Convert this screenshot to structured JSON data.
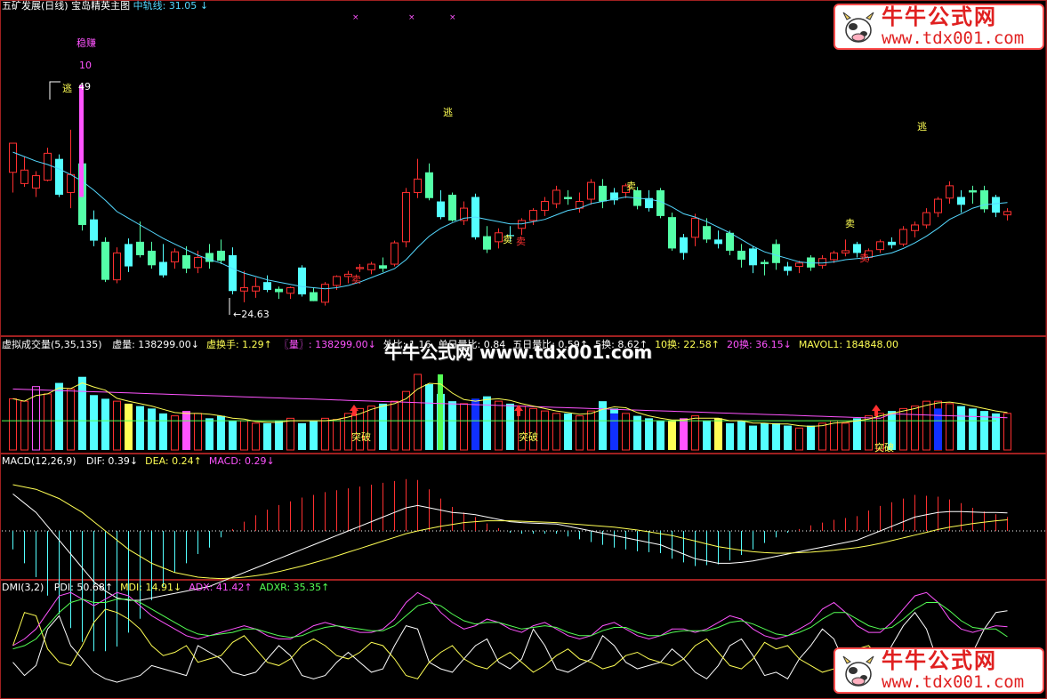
{
  "colors": {
    "up": "#ff3030",
    "down": "#54ffa8",
    "down_alt": "#54ffff",
    "ma": "#54d8ff",
    "white": "#ffffff",
    "yellow": "#ffff54",
    "magenta": "#ff54ff",
    "green": "#54ff54",
    "frame": "#a02020",
    "blue": "#1030ff"
  },
  "main": {
    "stock_title": "五矿发展(日线)",
    "indicator_title": "宝岛精英主图",
    "mid_line_label": "中轨线:",
    "mid_line_value": "31.05",
    "mid_line_arrow": "↓",
    "labels": {
      "wenzhuan": "稳赚",
      "ten": "10",
      "high_marker": "逃",
      "high_value": "49",
      "low_value": "24.63",
      "escape1": "逃",
      "escape2": "逃",
      "sell": "卖",
      "sell_label_2": "卖",
      "sell_label_3": "卖",
      "buy_sell_a": "卖",
      "buy_sell_b": "卖",
      "sell_label_4": "卖"
    }
  },
  "volume": {
    "title": "虚拟成交量(5,35,135)",
    "fields": [
      {
        "label": "虚量:",
        "value": "138299.00",
        "arrow": "↓",
        "color": "white"
      },
      {
        "label": "虚换手:",
        "value": "1.29",
        "arrow": "↑",
        "color": "yellow"
      },
      {
        "label": "〖量〗:",
        "value": "138299.00",
        "arrow": "↓",
        "color": "magenta"
      },
      {
        "label": "外比:",
        "value": "1.16",
        "arrow": "",
        "color": "white"
      },
      {
        "label": "单日量比:",
        "value": "0.84",
        "arrow": "",
        "color": "white"
      },
      {
        "label": "五日量比:",
        "value": "0.59",
        "arrow": "↑",
        "color": "white"
      },
      {
        "label": "5换:",
        "value": "8.62",
        "arrow": "↑",
        "color": "white"
      },
      {
        "label": "10换:",
        "value": "22.58",
        "arrow": "↑",
        "color": "yellow"
      },
      {
        "label": "20换:",
        "value": "36.15",
        "arrow": "↓",
        "color": "magenta"
      },
      {
        "label": "MAVOL1:",
        "value": "184848.00",
        "arrow": "",
        "color": "yellow"
      }
    ],
    "breakout_label": "突破"
  },
  "macd": {
    "title": "MACD(12,26,9)",
    "fields": [
      {
        "label": "DIF:",
        "value": "0.39",
        "arrow": "↓",
        "color": "white"
      },
      {
        "label": "DEA:",
        "value": "0.24",
        "arrow": "↑",
        "color": "yellow"
      },
      {
        "label": "MACD:",
        "value": "0.29",
        "arrow": "↓",
        "color": "magenta"
      }
    ]
  },
  "dmi": {
    "title": "DMI(3,2)",
    "fields": [
      {
        "label": "PDI:",
        "value": "50.68",
        "arrow": "↑",
        "color": "white"
      },
      {
        "label": "MDI:",
        "value": "14.91",
        "arrow": "↓",
        "color": "yellow"
      },
      {
        "label": "ADX:",
        "value": "41.42",
        "arrow": "↑",
        "color": "magenta"
      },
      {
        "label": "ADXR:",
        "value": "35.35",
        "arrow": "↑",
        "color": "green"
      }
    ]
  },
  "watermark": {
    "brand": "牛牛公式网",
    "url": "www.tdx001.com",
    "banner": "牛牛公式网 www.tdx001.com"
  },
  "chart_data": {
    "type": "candlestick",
    "price_range": [
      23,
      50
    ],
    "candles": [
      {
        "o": 36.2,
        "h": 37.4,
        "l": 34.4,
        "c": 38.8
      },
      {
        "o": 35.2,
        "h": 37.6,
        "l": 34.9,
        "c": 36.4
      },
      {
        "o": 34.8,
        "h": 36.3,
        "l": 34.0,
        "c": 35.9
      },
      {
        "o": 35.5,
        "h": 38.4,
        "l": 35.4,
        "c": 37.9
      },
      {
        "o": 37.4,
        "h": 37.8,
        "l": 34.0,
        "c": 34.2
      },
      {
        "o": 34.4,
        "h": 40.0,
        "l": 33.0,
        "c": 36.0
      },
      {
        "o": 37.0,
        "h": 37.5,
        "l": 31.0,
        "c": 31.5
      },
      {
        "o": 32.0,
        "h": 32.8,
        "l": 29.6,
        "c": 30.1
      },
      {
        "o": 30.0,
        "h": 30.4,
        "l": 26.4,
        "c": 26.6
      },
      {
        "o": 26.6,
        "h": 29.5,
        "l": 26.3,
        "c": 29.0
      },
      {
        "o": 29.8,
        "h": 30.3,
        "l": 27.3,
        "c": 27.8
      },
      {
        "o": 30.0,
        "h": 31.8,
        "l": 28.6,
        "c": 28.8
      },
      {
        "o": 29.2,
        "h": 30.0,
        "l": 27.6,
        "c": 27.9
      },
      {
        "o": 28.2,
        "h": 29.8,
        "l": 26.8,
        "c": 27.0
      },
      {
        "o": 28.2,
        "h": 29.4,
        "l": 27.6,
        "c": 29.1
      },
      {
        "o": 28.8,
        "h": 29.6,
        "l": 27.2,
        "c": 27.6
      },
      {
        "o": 27.7,
        "h": 29.2,
        "l": 27.2,
        "c": 28.6
      },
      {
        "o": 29.0,
        "h": 29.8,
        "l": 27.6,
        "c": 28.2
      },
      {
        "o": 29.2,
        "h": 30.2,
        "l": 28.0,
        "c": 28.3
      },
      {
        "o": 28.8,
        "h": 29.5,
        "l": 25.3,
        "c": 25.6
      },
      {
        "o": 25.6,
        "h": 27.4,
        "l": 24.6,
        "c": 25.9
      },
      {
        "o": 25.6,
        "h": 26.8,
        "l": 25.0,
        "c": 26.0
      },
      {
        "o": 26.4,
        "h": 27.0,
        "l": 25.5,
        "c": 25.7
      },
      {
        "o": 25.8,
        "h": 26.0,
        "l": 24.9,
        "c": 25.5
      },
      {
        "o": 25.4,
        "h": 26.0,
        "l": 24.9,
        "c": 25.9
      },
      {
        "o": 27.7,
        "h": 27.9,
        "l": 25.1,
        "c": 25.3
      },
      {
        "o": 25.5,
        "h": 25.9,
        "l": 24.8,
        "c": 24.7
      },
      {
        "o": 24.6,
        "h": 26.4,
        "l": 24.3,
        "c": 26.2
      },
      {
        "o": 26.1,
        "h": 27.0,
        "l": 25.7,
        "c": 26.9
      },
      {
        "o": 26.9,
        "h": 27.4,
        "l": 26.3,
        "c": 27.1
      },
      {
        "o": 27.6,
        "h": 28.0,
        "l": 27.3,
        "c": 27.7
      },
      {
        "o": 27.5,
        "h": 28.2,
        "l": 27.1,
        "c": 28.0
      },
      {
        "o": 27.9,
        "h": 28.6,
        "l": 27.3,
        "c": 27.6
      },
      {
        "o": 28.0,
        "h": 30.1,
        "l": 27.8,
        "c": 29.9
      },
      {
        "o": 30.0,
        "h": 34.8,
        "l": 29.5,
        "c": 34.4
      },
      {
        "o": 34.4,
        "h": 37.4,
        "l": 33.9,
        "c": 35.6
      },
      {
        "o": 36.2,
        "h": 37.0,
        "l": 33.7,
        "c": 33.9
      },
      {
        "o": 33.6,
        "h": 34.6,
        "l": 32.0,
        "c": 32.2
      },
      {
        "o": 34.2,
        "h": 34.4,
        "l": 31.8,
        "c": 31.9
      },
      {
        "o": 31.9,
        "h": 33.6,
        "l": 31.5,
        "c": 33.0
      },
      {
        "o": 34.0,
        "h": 34.3,
        "l": 30.2,
        "c": 30.4
      },
      {
        "o": 30.5,
        "h": 31.4,
        "l": 29.0,
        "c": 29.3
      },
      {
        "o": 30.0,
        "h": 31.2,
        "l": 29.4,
        "c": 30.8
      },
      {
        "o": 30.6,
        "h": 31.4,
        "l": 30.0,
        "c": 30.5
      },
      {
        "o": 31.2,
        "h": 32.1,
        "l": 30.6,
        "c": 31.9
      },
      {
        "o": 31.9,
        "h": 33.0,
        "l": 31.5,
        "c": 32.8
      },
      {
        "o": 32.8,
        "h": 34.0,
        "l": 32.3,
        "c": 33.6
      },
      {
        "o": 33.4,
        "h": 35.0,
        "l": 33.0,
        "c": 34.6
      },
      {
        "o": 34.0,
        "h": 34.6,
        "l": 33.3,
        "c": 33.8
      },
      {
        "o": 33.0,
        "h": 34.4,
        "l": 32.6,
        "c": 33.6
      },
      {
        "o": 33.8,
        "h": 35.6,
        "l": 33.3,
        "c": 35.3
      },
      {
        "o": 35.0,
        "h": 35.6,
        "l": 33.0,
        "c": 33.6
      },
      {
        "o": 34.4,
        "h": 34.8,
        "l": 33.3,
        "c": 33.7
      },
      {
        "o": 34.4,
        "h": 35.2,
        "l": 33.9,
        "c": 35.0
      },
      {
        "o": 34.6,
        "h": 34.9,
        "l": 32.9,
        "c": 33.2
      },
      {
        "o": 33.9,
        "h": 34.6,
        "l": 32.7,
        "c": 33.0
      },
      {
        "o": 34.6,
        "h": 34.8,
        "l": 32.1,
        "c": 32.3
      },
      {
        "o": 32.2,
        "h": 32.6,
        "l": 29.2,
        "c": 29.4
      },
      {
        "o": 30.4,
        "h": 30.7,
        "l": 28.4,
        "c": 29.0
      },
      {
        "o": 30.4,
        "h": 32.5,
        "l": 29.6,
        "c": 32.1
      },
      {
        "o": 31.4,
        "h": 32.1,
        "l": 29.9,
        "c": 30.2
      },
      {
        "o": 30.2,
        "h": 31.0,
        "l": 29.4,
        "c": 29.8
      },
      {
        "o": 30.8,
        "h": 31.0,
        "l": 28.8,
        "c": 29.2
      },
      {
        "o": 29.2,
        "h": 29.8,
        "l": 27.7,
        "c": 28.4
      },
      {
        "o": 29.4,
        "h": 29.6,
        "l": 27.2,
        "c": 27.9
      },
      {
        "o": 28.2,
        "h": 28.4,
        "l": 27.0,
        "c": 28.0
      },
      {
        "o": 29.8,
        "h": 30.2,
        "l": 27.5,
        "c": 28.1
      },
      {
        "o": 27.8,
        "h": 28.2,
        "l": 27.0,
        "c": 27.4
      },
      {
        "o": 27.8,
        "h": 28.3,
        "l": 27.2,
        "c": 28.1
      },
      {
        "o": 28.6,
        "h": 28.8,
        "l": 27.4,
        "c": 27.7
      },
      {
        "o": 27.9,
        "h": 28.8,
        "l": 27.6,
        "c": 28.5
      },
      {
        "o": 28.4,
        "h": 29.2,
        "l": 28.1,
        "c": 29.0
      },
      {
        "o": 29.0,
        "h": 30.2,
        "l": 28.7,
        "c": 29.2
      },
      {
        "o": 29.8,
        "h": 30.0,
        "l": 28.6,
        "c": 29.0
      },
      {
        "o": 28.6,
        "h": 29.4,
        "l": 28.3,
        "c": 29.2
      },
      {
        "o": 29.3,
        "h": 30.2,
        "l": 29.0,
        "c": 30.0
      },
      {
        "o": 30.0,
        "h": 30.4,
        "l": 29.4,
        "c": 29.7
      },
      {
        "o": 29.8,
        "h": 31.4,
        "l": 29.6,
        "c": 31.1
      },
      {
        "o": 31.0,
        "h": 31.8,
        "l": 30.4,
        "c": 31.5
      },
      {
        "o": 31.5,
        "h": 33.0,
        "l": 31.2,
        "c": 32.6
      },
      {
        "o": 32.6,
        "h": 34.0,
        "l": 32.2,
        "c": 33.8
      },
      {
        "o": 33.9,
        "h": 35.4,
        "l": 33.4,
        "c": 35.0
      },
      {
        "o": 34.0,
        "h": 34.6,
        "l": 32.6,
        "c": 33.3
      },
      {
        "o": 34.6,
        "h": 35.0,
        "l": 33.4,
        "c": 34.4
      },
      {
        "o": 34.6,
        "h": 35.0,
        "l": 32.6,
        "c": 32.9
      },
      {
        "o": 34.0,
        "h": 34.2,
        "l": 32.2,
        "c": 32.6
      },
      {
        "o": 32.4,
        "h": 33.0,
        "l": 31.9,
        "c": 32.7
      }
    ],
    "ma": [
      38.0,
      37.6,
      37.2,
      36.9,
      36.5,
      36.0,
      35.4,
      34.6,
      33.7,
      32.7,
      32.1,
      31.5,
      30.9,
      30.3,
      29.8,
      29.3,
      28.8,
      28.4,
      28.1,
      27.6,
      27.2,
      26.9,
      26.6,
      26.4,
      26.2,
      26.0,
      25.9,
      25.8,
      25.9,
      26.1,
      26.4,
      26.8,
      27.2,
      27.6,
      28.4,
      29.5,
      30.5,
      31.2,
      31.7,
      32.1,
      32.2,
      32.0,
      31.8,
      31.6,
      31.6,
      31.8,
      32.0,
      32.4,
      32.8,
      33.0,
      33.4,
      33.6,
      33.8,
      34.0,
      33.9,
      33.8,
      33.6,
      33.1,
      32.5,
      32.2,
      31.8,
      31.3,
      30.8,
      30.2,
      29.6,
      29.1,
      28.8,
      28.5,
      28.2,
      28.1,
      28.1,
      28.2,
      28.4,
      28.5,
      28.6,
      28.8,
      29.0,
      29.4,
      29.9,
      30.5,
      31.2,
      32.0,
      32.5,
      33.0,
      33.3,
      33.4,
      33.5
    ],
    "volume": [
      42,
      40,
      52,
      46,
      55,
      50,
      60,
      45,
      42,
      40,
      38,
      36,
      34,
      30,
      28,
      32,
      30,
      26,
      28,
      24,
      24,
      22,
      22,
      24,
      26,
      22,
      24,
      26,
      25,
      30,
      34,
      36,
      38,
      40,
      48,
      62,
      54,
      46,
      40,
      38,
      42,
      44,
      40,
      38,
      36,
      34,
      32,
      30,
      30,
      28,
      32,
      40,
      34,
      30,
      28,
      26,
      24,
      24,
      26,
      28,
      24,
      26,
      22,
      24,
      20,
      22,
      22,
      20,
      18,
      20,
      22,
      24,
      22,
      26,
      28,
      30,
      32,
      34,
      36,
      40,
      40,
      38,
      36,
      34,
      32,
      30,
      30
    ],
    "macd_dif": [
      0.8,
      0.6,
      0.4,
      0.1,
      -0.2,
      -0.5,
      -0.8,
      -1.1,
      -1.3,
      -1.45,
      -1.5,
      -1.5,
      -1.45,
      -1.4,
      -1.35,
      -1.3,
      -1.25,
      -1.2,
      -1.1,
      -1.0,
      -0.9,
      -0.8,
      -0.7,
      -0.6,
      -0.5,
      -0.4,
      -0.3,
      -0.2,
      -0.1,
      0.0,
      0.1,
      0.2,
      0.3,
      0.4,
      0.5,
      0.55,
      0.5,
      0.45,
      0.4,
      0.38,
      0.35,
      0.3,
      0.25,
      0.2,
      0.18,
      0.17,
      0.16,
      0.15,
      0.1,
      0.05,
      0.0,
      -0.05,
      -0.1,
      -0.15,
      -0.2,
      -0.25,
      -0.3,
      -0.4,
      -0.5,
      -0.6,
      -0.65,
      -0.7,
      -0.7,
      -0.68,
      -0.65,
      -0.6,
      -0.55,
      -0.5,
      -0.45,
      -0.4,
      -0.35,
      -0.3,
      -0.25,
      -0.2,
      -0.1,
      0.0,
      0.1,
      0.2,
      0.3,
      0.35,
      0.4,
      0.42,
      0.42,
      0.41,
      0.4,
      0.4,
      0.39
    ],
    "macd_dea": [
      1.0,
      0.95,
      0.9,
      0.8,
      0.7,
      0.55,
      0.4,
      0.2,
      0.0,
      -0.2,
      -0.4,
      -0.55,
      -0.7,
      -0.8,
      -0.9,
      -0.95,
      -1.0,
      -1.02,
      -1.03,
      -1.02,
      -1.0,
      -0.97,
      -0.93,
      -0.88,
      -0.82,
      -0.76,
      -0.69,
      -0.62,
      -0.54,
      -0.46,
      -0.38,
      -0.3,
      -0.22,
      -0.14,
      -0.06,
      0.0,
      0.05,
      0.1,
      0.14,
      0.18,
      0.2,
      0.22,
      0.22,
      0.22,
      0.21,
      0.2,
      0.19,
      0.18,
      0.16,
      0.14,
      0.12,
      0.1,
      0.08,
      0.05,
      0.02,
      -0.02,
      -0.06,
      -0.1,
      -0.16,
      -0.22,
      -0.28,
      -0.34,
      -0.38,
      -0.42,
      -0.45,
      -0.47,
      -0.48,
      -0.48,
      -0.47,
      -0.46,
      -0.44,
      -0.42,
      -0.39,
      -0.36,
      -0.32,
      -0.27,
      -0.21,
      -0.15,
      -0.09,
      -0.03,
      0.03,
      0.08,
      0.12,
      0.16,
      0.19,
      0.22,
      0.24
    ],
    "dmi_pdi": [
      20,
      12,
      18,
      40,
      48,
      30,
      22,
      14,
      10,
      8,
      10,
      12,
      18,
      16,
      14,
      12,
      30,
      26,
      22,
      14,
      12,
      14,
      22,
      30,
      24,
      12,
      10,
      12,
      20,
      26,
      20,
      14,
      16,
      30,
      42,
      40,
      20,
      16,
      14,
      22,
      30,
      34,
      20,
      16,
      22,
      40,
      30,
      16,
      14,
      18,
      22,
      36,
      30,
      20,
      16,
      18,
      20,
      28,
      22,
      14,
      10,
      18,
      30,
      34,
      24,
      12,
      14,
      10,
      22,
      30,
      40,
      34,
      18,
      12,
      10,
      16,
      30,
      42,
      50,
      40,
      20,
      12,
      16,
      26,
      40,
      50,
      51
    ],
    "dmi_mdi": [
      30,
      50,
      48,
      28,
      20,
      18,
      30,
      44,
      52,
      50,
      46,
      40,
      30,
      24,
      26,
      30,
      20,
      22,
      24,
      32,
      36,
      28,
      20,
      18,
      22,
      30,
      34,
      30,
      24,
      22,
      26,
      32,
      30,
      22,
      12,
      10,
      20,
      26,
      30,
      22,
      18,
      16,
      22,
      26,
      20,
      14,
      18,
      24,
      28,
      22,
      20,
      16,
      18,
      24,
      26,
      22,
      20,
      18,
      22,
      30,
      34,
      26,
      18,
      16,
      22,
      32,
      28,
      30,
      22,
      18,
      14,
      16,
      24,
      28,
      30,
      22,
      16,
      12,
      14,
      16,
      22,
      28,
      24,
      18,
      16,
      15,
      14.9
    ],
    "dmi_adx": [
      30,
      34,
      40,
      50,
      60,
      62,
      58,
      54,
      58,
      62,
      60,
      54,
      48,
      44,
      40,
      36,
      34,
      36,
      38,
      40,
      42,
      40,
      36,
      34,
      34,
      38,
      42,
      44,
      42,
      40,
      38,
      38,
      40,
      46,
      56,
      62,
      58,
      50,
      44,
      40,
      42,
      46,
      44,
      40,
      38,
      42,
      44,
      40,
      36,
      34,
      36,
      42,
      44,
      40,
      36,
      34,
      36,
      40,
      40,
      38,
      40,
      44,
      48,
      46,
      40,
      36,
      34,
      36,
      40,
      44,
      52,
      56,
      50,
      42,
      38,
      38,
      44,
      52,
      60,
      62,
      56,
      46,
      40,
      38,
      40,
      42,
      41.4
    ],
    "dmi_adxr": [
      28,
      30,
      34,
      42,
      50,
      56,
      58,
      56,
      56,
      58,
      58,
      56,
      52,
      48,
      44,
      40,
      37,
      36,
      37,
      38,
      40,
      40,
      38,
      36,
      35,
      36,
      39,
      41,
      42,
      41,
      40,
      39,
      39,
      42,
      48,
      54,
      56,
      54,
      49,
      45,
      43,
      44,
      44,
      42,
      40,
      41,
      42,
      41,
      38,
      36,
      36,
      39,
      41,
      41,
      38,
      36,
      36,
      38,
      39,
      39,
      39,
      41,
      44,
      45,
      43,
      40,
      37,
      36,
      38,
      41,
      46,
      50,
      50,
      46,
      42,
      40,
      41,
      46,
      52,
      56,
      56,
      51,
      45,
      41,
      40,
      40,
      35.35
    ]
  }
}
